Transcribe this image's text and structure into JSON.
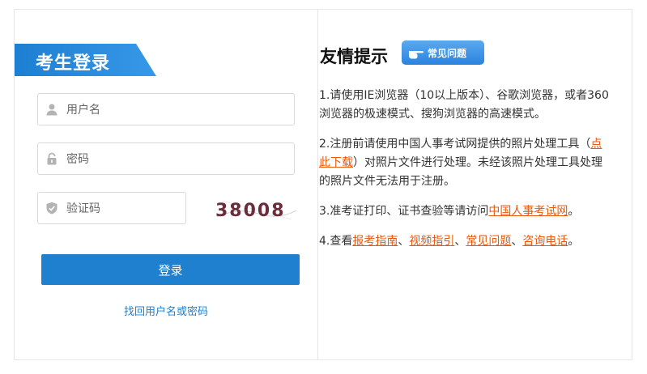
{
  "login": {
    "title": "考生登录",
    "username_placeholder": "用户名",
    "password_placeholder": "密码",
    "captcha_placeholder": "验证码",
    "captcha_text": "38008",
    "submit_label": "登录",
    "recover_link": "找回用户名或密码"
  },
  "notice": {
    "title": "友情提示",
    "faq_badge": "常见问题",
    "item1": "1.请使用IE浏览器（10以上版本）、谷歌浏览器，或者360浏览器的极速模式、搜狗浏览器的高速模式。",
    "item2_pre": "2.注册前请使用中国人事考试网提供的照片处理工具（",
    "item2_link": "点此下载",
    "item2_post": "）对照片文件进行处理。未经该照片处理工具处理的照片文件无法用于注册。",
    "item3_pre": "3.准考证打印、证书查验等请访问",
    "item3_link": "中国人事考试网",
    "item3_post": "。",
    "item4_pre": "4.查看",
    "item4_link1": "报考指南",
    "item4_sep1": "、",
    "item4_link2": "视频指引",
    "item4_sep2": "、",
    "item4_link3": "常见问题",
    "item4_sep3": "、",
    "item4_link4": "咨询电话",
    "item4_post": "。"
  },
  "colors": {
    "primary": "#1f80cf",
    "link_orange": "#e8590c",
    "border": "#e6e6e6"
  }
}
